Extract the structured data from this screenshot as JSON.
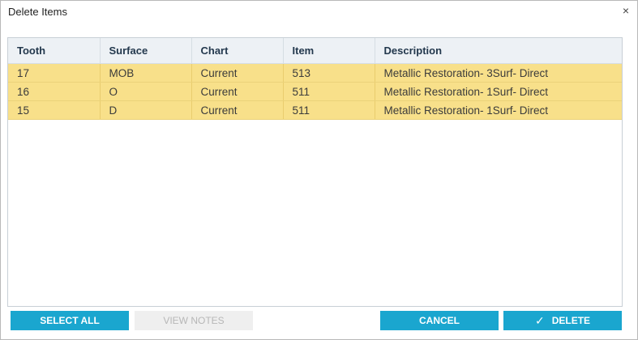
{
  "dialog": {
    "title": "Delete Items",
    "close_glyph": "×"
  },
  "table": {
    "columns": [
      "Tooth",
      "Surface",
      "Chart",
      "Item",
      "Description"
    ],
    "rows": [
      [
        "17",
        "MOB",
        "Current",
        "513",
        "Metallic Restoration- 3Surf- Direct"
      ],
      [
        "16",
        "O",
        "Current",
        "511",
        "Metallic Restoration- 1Surf- Direct"
      ],
      [
        "15",
        "D",
        "Current",
        "511",
        "Metallic Restoration- 1Surf- Direct"
      ]
    ],
    "row_highlight_color": "#f8e08a",
    "header_bg_color": "#edf1f5"
  },
  "buttons": {
    "select_all": "SELECT ALL",
    "view_notes": "VIEW NOTES",
    "cancel": "CANCEL",
    "delete": "DELETE",
    "delete_icon": "check-icon",
    "accent_color": "#1aa6cf"
  }
}
